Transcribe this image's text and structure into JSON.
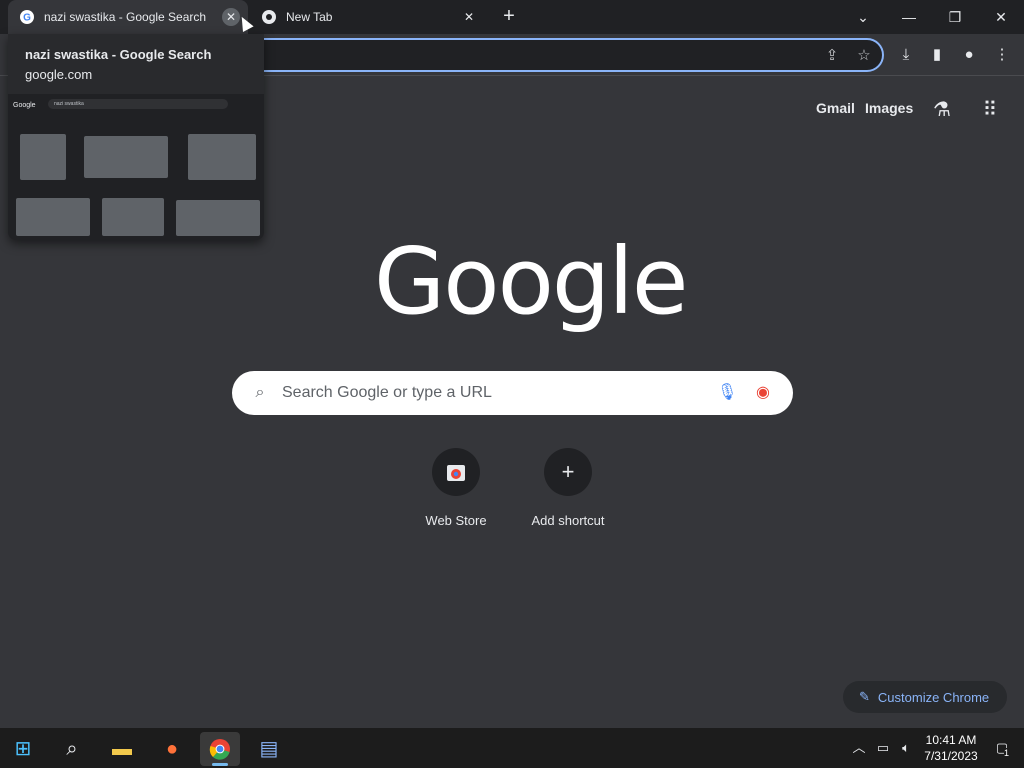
{
  "tabs": [
    {
      "title": "nazi swastika - Google Search",
      "favicon": "google-g-icon",
      "active": true
    },
    {
      "title": "New Tab",
      "favicon": "chrome-icon",
      "active": false
    }
  ],
  "tab_controls": {
    "new_tab": "+",
    "close": "✕"
  },
  "window_controls": {
    "tab_search": "⌄",
    "minimize": "—",
    "restore": "❐",
    "close": "✕"
  },
  "toolbar_icons": [
    "share-icon",
    "star-icon",
    "download-icon",
    "side-panel-icon",
    "profile-icon",
    "menu-icon"
  ],
  "hover_card": {
    "title": "nazi swastika - Google Search",
    "domain": "google.com",
    "preview_logo": "Google",
    "preview_query": "nazi swastika"
  },
  "ntp_header": {
    "gmail": "Gmail",
    "images": "Images"
  },
  "logo_text": "Google",
  "search": {
    "placeholder": "Search Google or type a URL"
  },
  "shortcuts": [
    {
      "label": "Web Store",
      "icon": "web-store-icon"
    },
    {
      "label": "Add shortcut",
      "icon": "plus-icon"
    }
  ],
  "customize": {
    "label": "Customize Chrome"
  },
  "taskbar": {
    "apps": [
      "windows-start-icon",
      "search-icon",
      "file-explorer-icon",
      "firefox-icon",
      "chrome-icon",
      "notepad-icon"
    ],
    "time": "10:41 AM",
    "date": "7/31/2023",
    "notification_count": "1"
  },
  "colors": {
    "accent": "#8ab4f8",
    "background": "#35363a",
    "tabstrip": "#202124"
  }
}
